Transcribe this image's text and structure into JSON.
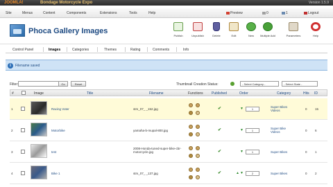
{
  "app": {
    "brand": "JOOMLA!",
    "site_name": "Bondage Motorcycle Expo",
    "version": "Version 1.5.9"
  },
  "menubar": {
    "items": [
      "Site",
      "Menus",
      "Content",
      "Components",
      "Extensions",
      "Tools",
      "Help"
    ],
    "status": {
      "preview": "Preview",
      "messages": "0",
      "users": "1",
      "logout": "Logout"
    }
  },
  "header": {
    "title": "Phoca Gallery Images",
    "toolbar": [
      "Publish",
      "Unpublish",
      "Delete",
      "Edit",
      "New",
      "Multiple Add",
      "Parameters",
      "Help"
    ]
  },
  "subnav": [
    "Control Panel",
    "Images",
    "Categories",
    "Themes",
    "Rating",
    "Comments",
    "Info"
  ],
  "message": "Filename saved",
  "filter": {
    "label": "Filter:",
    "go_label": "Go",
    "reset_label": "Reset",
    "thumb_label": "Thumbnail Creation Status:",
    "category_select": "- Select Category -",
    "state_select": "- Select State -"
  },
  "table": {
    "headers": [
      "#",
      "",
      "Image",
      "Title",
      "Filename",
      "Functions",
      "Published",
      "Order",
      "Category",
      "Hits",
      "ID"
    ],
    "rows": [
      {
        "num": "1",
        "title": "Racing Voter",
        "filename": "stm_07_ _152.jpg",
        "order": "1",
        "category": "Super Bikes Videos",
        "hits": "0",
        "id": "15"
      },
      {
        "num": "2",
        "title": "Motorbike",
        "filename": "yamaha-b-mupal-800.jpg",
        "order": "1",
        "category": "Super Bike Videos",
        "hits": "0",
        "id": "6"
      },
      {
        "num": "3",
        "title": "test",
        "filename": "2008-Honda-tuned-super-bike-cbr-motorcycle.jpg",
        "order": "1",
        "category": "Super Bikes",
        "hits": "0",
        "id": "1"
      },
      {
        "num": "4",
        "title": "Bike 1",
        "filename": "stm_07_ _137.jpg",
        "order": "2",
        "category": "Super Bikes",
        "hits": "0",
        "id": "2"
      }
    ]
  },
  "colors": {
    "title_blue": "#1d4a82",
    "message_bg": "#cfe3f6",
    "highlight_row": "#fffbd8",
    "published_green": "#3a8a2a"
  }
}
